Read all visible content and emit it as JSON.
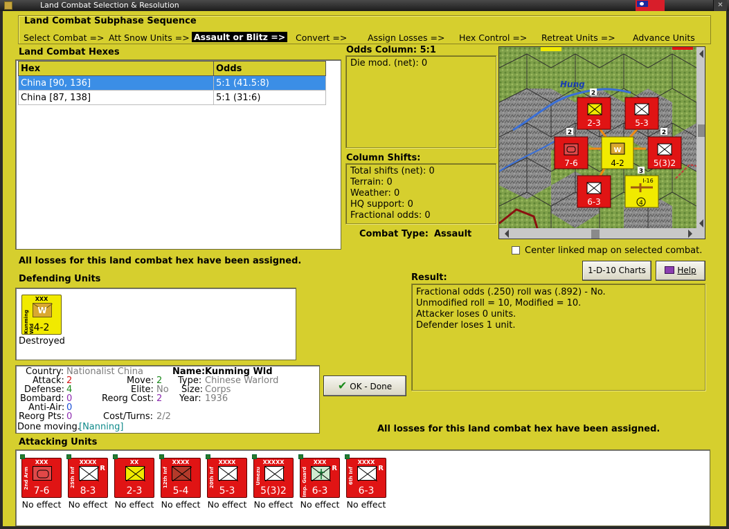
{
  "window": {
    "title": "Land Combat Selection & Resolution"
  },
  "subphase": {
    "heading": "Land Combat Subphase Sequence",
    "steps": [
      {
        "label": "Select Combat =>"
      },
      {
        "label": "Att Snow Units =>"
      },
      {
        "label": "Assault or Blitz =>"
      },
      {
        "label": "Convert =>"
      },
      {
        "label": "Assign Losses =>"
      },
      {
        "label": "Hex Control =>"
      },
      {
        "label": "Retreat Units =>"
      },
      {
        "label": "Advance Units"
      }
    ],
    "active_index": 2
  },
  "hexes": {
    "heading": "Land Combat Hexes",
    "columns": [
      "Hex",
      "Odds"
    ],
    "rows": [
      {
        "hex": "China [90, 136]",
        "odds": "5:1 (41.5:8)",
        "selected": true
      },
      {
        "hex": "China [87, 138]",
        "odds": "5:1 (31:6)",
        "selected": false
      }
    ]
  },
  "odds": {
    "heading": "Odds Column: 5:1",
    "die_mod": "Die mod. (net): 0"
  },
  "shifts": {
    "heading": "Column Shifts:",
    "lines": [
      "Total shifts (net): 0",
      "Terrain: 0",
      "Weather: 0",
      "HQ support: 0",
      "Fractional odds: 0"
    ]
  },
  "combat_type": {
    "label": "Combat Type:",
    "value": "Assault"
  },
  "center_map": {
    "label": "Center linked map on selected combat.",
    "checked": false
  },
  "buttons": {
    "charts": "1-D-10 Charts",
    "help": "Help",
    "ok": "OK - Done"
  },
  "status_message": "All losses for this land combat hex have been assigned.",
  "defending": {
    "heading": "Defending Units",
    "units": [
      {
        "designation": "XXX",
        "side_name": "Kunming Wld",
        "strength": "4-2",
        "type": "warlord",
        "color": "yellow",
        "status": "Destroyed",
        "mark": "W"
      }
    ]
  },
  "result": {
    "heading": "Result:",
    "lines": [
      "Fractional odds (.250) roll was (.892)  - No.",
      "Unmodified roll = 10, Modified = 10.",
      "Attacker loses 0 units.",
      "Defender loses 1 unit."
    ]
  },
  "unit_info": {
    "country_label": "Country:",
    "country": "Nationalist China",
    "attack_label": "Attack:",
    "attack": "2",
    "defense_label": "Defense:",
    "defense": "4",
    "bombard_label": "Bombard:",
    "bombard": "0",
    "antiair_label": "Anti-Air:",
    "antiair": "0",
    "reorg_pts_label": "Reorg Pts:",
    "reorg_pts": "0",
    "done_moving": "Done moving.",
    "done_loc": "[Nanning]",
    "move_label": "Move:",
    "move": "2",
    "elite_label": "Elite:",
    "elite": "No",
    "reorg_cost_label": "Reorg Cost:",
    "reorg_cost": "2",
    "cost_turns_label": "Cost/Turns:",
    "cost_turns": "2/2",
    "name_label": "Name:",
    "name": "Kunming Wld",
    "type_label": "Type:",
    "type": "Chinese Warlord",
    "size_label": "Size:",
    "size": "Corps",
    "year_label": "Year:",
    "year": "1936"
  },
  "attacking": {
    "heading": "Attacking Units",
    "units": [
      {
        "designation": "XXX",
        "side_name": "2nd Arm",
        "strength": "7-6",
        "type": "armor",
        "reserve": false,
        "status": "No effect"
      },
      {
        "designation": "XXXX",
        "side_name": "25th Inf",
        "strength": "8-3",
        "type": "infantry",
        "reserve": true,
        "status": "No effect"
      },
      {
        "designation": "XX",
        "side_name": "",
        "strength": "2-3",
        "type": "infantry-yellow",
        "reserve": false,
        "status": "No effect"
      },
      {
        "designation": "XXXX",
        "side_name": "12th Inf",
        "strength": "5-4",
        "type": "infantry-dark",
        "reserve": false,
        "status": "No effect"
      },
      {
        "designation": "XXXX",
        "side_name": "20th Inf",
        "strength": "5-3",
        "type": "infantry",
        "reserve": false,
        "status": "No effect"
      },
      {
        "designation": "XXXXX",
        "side_name": "Umezu",
        "strength": "5(3)2",
        "type": "infantry",
        "reserve": false,
        "status": "No effect"
      },
      {
        "designation": "XXX",
        "side_name": "Imp. Guard",
        "strength": "6-3",
        "type": "guard",
        "reserve": true,
        "status": "No effect"
      },
      {
        "designation": "XXXX",
        "side_name": "6th Inf",
        "strength": "6-3",
        "type": "infantry",
        "reserve": true,
        "status": "No effect"
      }
    ]
  },
  "map": {
    "river_label": "Hung",
    "colors": {
      "mountain": "#8e8e8e",
      "forest": "#7fa04a",
      "red": "#e01414",
      "yellow": "#f1ea00",
      "river": "#3a6fd6"
    },
    "units": [
      {
        "strength": "2-3",
        "designation": "XX",
        "count": "2"
      },
      {
        "strength": "5-3",
        "designation": "XXXX",
        "count": ""
      },
      {
        "strength": "7-6",
        "designation": "XXX",
        "count": "2"
      },
      {
        "strength": "4-2",
        "designation": "XXX",
        "count": ""
      },
      {
        "strength": "5(3)2",
        "designation": "XXXXX",
        "count": "2"
      },
      {
        "strength": "6-3",
        "designation": "XXXX",
        "count": ""
      },
      {
        "strength": "I-16",
        "designation": "",
        "count": "3"
      }
    ]
  }
}
